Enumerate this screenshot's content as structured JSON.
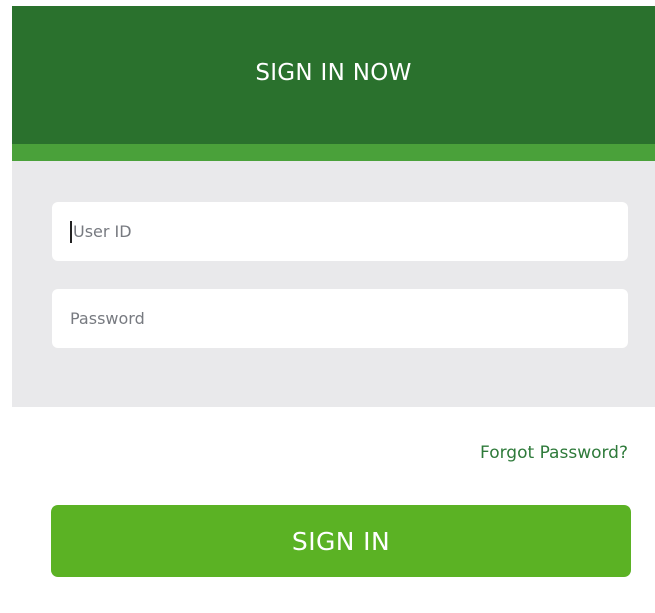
{
  "header": {
    "title": "SIGN IN NOW"
  },
  "form": {
    "user_id": {
      "value": "",
      "placeholder": "User ID"
    },
    "password": {
      "value": "",
      "placeholder": "Password"
    },
    "forgot_label": "Forgot Password?",
    "submit_label": "SIGN IN"
  },
  "colors": {
    "header_bg": "#2a712d",
    "header_stripe": "#4aa13a",
    "form_bg": "#e9e9eb",
    "button_bg": "#5bb224",
    "link": "#2e7a3a"
  }
}
